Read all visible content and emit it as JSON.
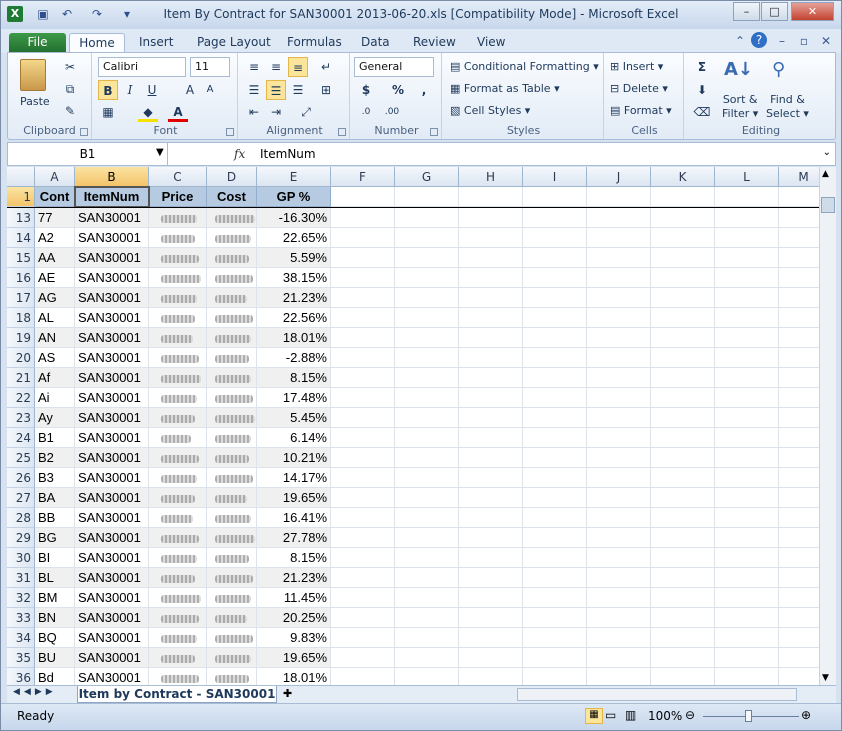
{
  "window": {
    "title": "Item By Contract for SAN30001 2013-06-20.xls  [Compatibility Mode]  -  Microsoft Excel",
    "app_icon": "excel-logo-icon"
  },
  "tabs": [
    "File",
    "Home",
    "Insert",
    "Page Layout",
    "Formulas",
    "Data",
    "Review",
    "View"
  ],
  "ribbon": {
    "clipboard": {
      "label": "Clipboard",
      "paste": "Paste"
    },
    "font": {
      "label": "Font",
      "family": "Calibri",
      "size": "11",
      "bold": "B",
      "italic": "I",
      "underline": "U"
    },
    "alignment": {
      "label": "Alignment"
    },
    "number": {
      "label": "Number",
      "format": "General",
      "currency": "$",
      "percent": "%",
      "comma": ","
    },
    "styles": {
      "label": "Styles",
      "conditional": "Conditional Formatting",
      "table": "Format as Table",
      "cell_styles": "Cell Styles"
    },
    "cells": {
      "label": "Cells",
      "insert": "Insert",
      "delete": "Delete",
      "format": "Format"
    },
    "editing": {
      "label": "Editing",
      "sum": "Σ",
      "sort": "Sort &",
      "sort2": "Filter",
      "find": "Find &",
      "find2": "Select"
    }
  },
  "formula_bar": {
    "name_box": "B1",
    "fx": "fx",
    "content": "ItemNum"
  },
  "columns": [
    "A",
    "B",
    "C",
    "D",
    "E",
    "F",
    "G",
    "H",
    "I",
    "J",
    "K",
    "L",
    "M"
  ],
  "header_row": {
    "row_num": "1",
    "cells": [
      "Cont",
      "ItemNum",
      "Price",
      "Cost",
      "GP %"
    ]
  },
  "rows": [
    {
      "n": "13",
      "cont": "77",
      "item": "SAN30001",
      "gp": "-16.30%"
    },
    {
      "n": "14",
      "cont": "A2",
      "item": "SAN30001",
      "gp": "22.65%"
    },
    {
      "n": "15",
      "cont": "AA",
      "item": "SAN30001",
      "gp": "5.59%"
    },
    {
      "n": "16",
      "cont": "AE",
      "item": "SAN30001",
      "gp": "38.15%"
    },
    {
      "n": "17",
      "cont": "AG",
      "item": "SAN30001",
      "gp": "21.23%"
    },
    {
      "n": "18",
      "cont": "AL",
      "item": "SAN30001",
      "gp": "22.56%"
    },
    {
      "n": "19",
      "cont": "AN",
      "item": "SAN30001",
      "gp": "18.01%"
    },
    {
      "n": "20",
      "cont": "AS",
      "item": "SAN30001",
      "gp": "-2.88%"
    },
    {
      "n": "21",
      "cont": "Af",
      "item": "SAN30001",
      "gp": "8.15%"
    },
    {
      "n": "22",
      "cont": "Ai",
      "item": "SAN30001",
      "gp": "17.48%"
    },
    {
      "n": "23",
      "cont": "Ay",
      "item": "SAN30001",
      "gp": "5.45%"
    },
    {
      "n": "24",
      "cont": "B1",
      "item": "SAN30001",
      "gp": "6.14%"
    },
    {
      "n": "25",
      "cont": "B2",
      "item": "SAN30001",
      "gp": "10.21%"
    },
    {
      "n": "26",
      "cont": "B3",
      "item": "SAN30001",
      "gp": "14.17%"
    },
    {
      "n": "27",
      "cont": "BA",
      "item": "SAN30001",
      "gp": "19.65%"
    },
    {
      "n": "28",
      "cont": "BB",
      "item": "SAN30001",
      "gp": "16.41%"
    },
    {
      "n": "29",
      "cont": "BG",
      "item": "SAN30001",
      "gp": "27.78%"
    },
    {
      "n": "30",
      "cont": "BI",
      "item": "SAN30001",
      "gp": "8.15%"
    },
    {
      "n": "31",
      "cont": "BL",
      "item": "SAN30001",
      "gp": "21.23%"
    },
    {
      "n": "32",
      "cont": "BM",
      "item": "SAN30001",
      "gp": "11.45%"
    },
    {
      "n": "33",
      "cont": "BN",
      "item": "SAN30001",
      "gp": "20.25%"
    },
    {
      "n": "34",
      "cont": "BQ",
      "item": "SAN30001",
      "gp": "9.83%"
    },
    {
      "n": "35",
      "cont": "BU",
      "item": "SAN30001",
      "gp": "19.65%"
    },
    {
      "n": "36",
      "cont": "Bd",
      "item": "SAN30001",
      "gp": "18.01%"
    }
  ],
  "sheet_tab": "Item by Contract - SAN30001",
  "status": {
    "ready": "Ready",
    "zoom": "100%"
  }
}
